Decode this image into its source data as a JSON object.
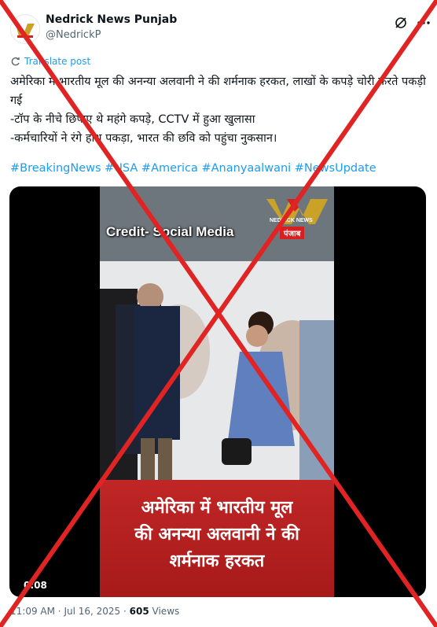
{
  "author": {
    "name": "Nedrick News Punjab",
    "handle": "@NedrickP"
  },
  "translate_label": "Translate post",
  "post_lines": [
    "अमेरिका में भारतीय मूल की अनन्या अलवानी ने की शर्मनाक हरकत, लाखों के कपड़े चोरी करते पकड़ी गई",
    "-टॉप के नीचे छिपाए थे महंगे कपड़े, CCTV में हुआ खुलासा",
    "-कर्मचारियों ने रंगे हाथ पकड़ा, भारत की छवि को पहुंचा नुकसान।"
  ],
  "hashtags": "#BreakingNews #USA #America #Ananyaalwani #NewsUpdate",
  "video": {
    "credit": "Credit- Social Media",
    "logo_sub": "NEDRICK NEWS",
    "logo_region": "पंजाब",
    "caption_lines": [
      "अमेरिका में भारतीय मूल",
      "की अनन्या अलवानी ने की",
      "शर्मनाक हरकत"
    ],
    "duration": "0:08"
  },
  "meta": {
    "time": "11:09 AM",
    "date": "Jul 16, 2025",
    "views_count": "605",
    "views_label": "Views"
  },
  "colors": {
    "link": "#1d9bf0",
    "cross": "#e02424",
    "caption_bg": "#b71f1f"
  }
}
